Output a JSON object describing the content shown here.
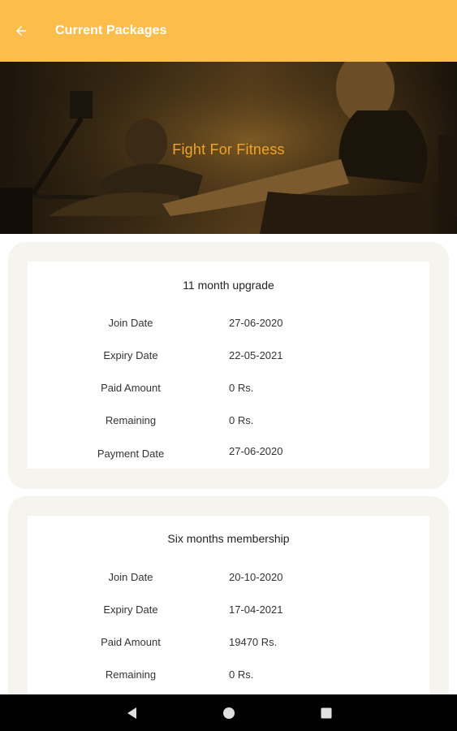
{
  "appbar": {
    "title": "Current Packages"
  },
  "banner": {
    "title": "Fight For Fitness"
  },
  "labels": {
    "join_date": "Join Date",
    "expiry_date": "Expiry Date",
    "paid_amount": "Paid Amount",
    "remaining": "Remaining",
    "payment_date": "Payment Date"
  },
  "packages": [
    {
      "name": "11 month upgrade",
      "join_date": "27-06-2020",
      "expiry_date": "22-05-2021",
      "paid_amount": "0 Rs.",
      "remaining": "0 Rs.",
      "payment_date": "27-06-2020"
    },
    {
      "name": "Six months membership",
      "join_date": "20-10-2020",
      "expiry_date": "17-04-2021",
      "paid_amount": "19470 Rs.",
      "remaining": "0 Rs."
    }
  ],
  "colors": {
    "accent": "#fdbd4a",
    "banner_text": "#f0a32c",
    "card_bg": "#f6f4ef"
  },
  "icons": {
    "back": "arrow-left-icon",
    "nav_back": "triangle-back-icon",
    "nav_home": "circle-home-icon",
    "nav_recents": "square-recents-icon"
  }
}
